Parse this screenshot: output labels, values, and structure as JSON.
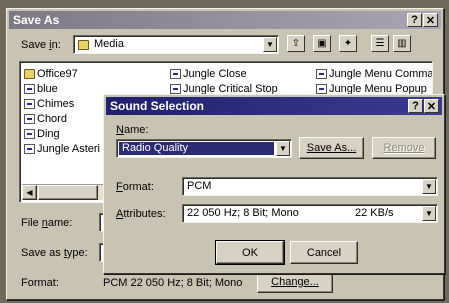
{
  "save_as": {
    "title": "Save As",
    "help_btn": "?",
    "close_btn": "✕",
    "save_in_label_pre": "Save ",
    "save_in_label_acc": "i",
    "save_in_label_post": "n:",
    "save_in_value": "Media",
    "files_col1": [
      "Office97",
      "blue",
      "Chimes",
      "Chord",
      "Ding",
      "Jungle Asteri"
    ],
    "files_col2": [
      "Jungle Close",
      "Jungle Critical Stop"
    ],
    "files_col3": [
      "Jungle Menu Commar",
      "Jungle Menu Popup"
    ],
    "file_name_label_pre": "File ",
    "file_name_label_acc": "n",
    "file_name_label_post": "ame:",
    "save_type_label_pre": "Save as ",
    "save_type_label_acc": "t",
    "save_type_label_post": "ype:",
    "format_label": "Format:",
    "format_value": "PCM 22 050 Hz; 8 Bit; Mono",
    "change_button": "Change..."
  },
  "sound_selection": {
    "title": "Sound Selection",
    "help_btn": "?",
    "close_btn": "✕",
    "name_label_acc": "N",
    "name_label_post": "ame:",
    "name_value": "Radio Quality",
    "save_as_button": "Save As...",
    "remove_button": "Remove",
    "format_label_acc": "F",
    "format_label_post": "ormat:",
    "format_value": "PCM",
    "attributes_label_acc": "A",
    "attributes_label_post": "ttributes:",
    "attributes_value": "22 050 Hz; 8 Bit; Mono",
    "attributes_rate": "22 KB/s",
    "ok_button": "OK",
    "cancel_button": "Cancel"
  }
}
